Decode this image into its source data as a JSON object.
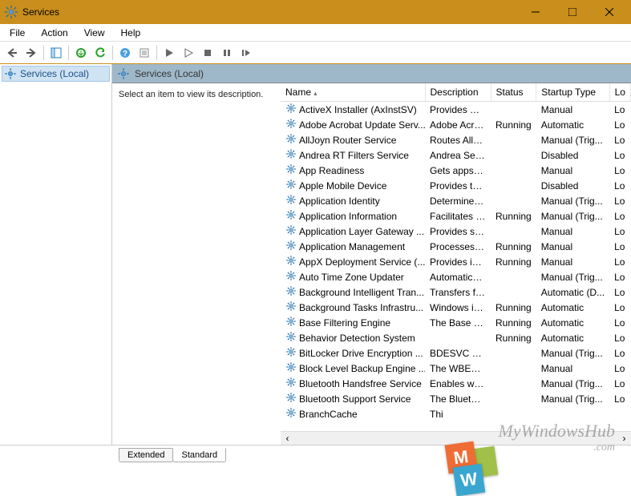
{
  "window": {
    "title": "Services"
  },
  "menu": {
    "file": "File",
    "action": "Action",
    "view": "View",
    "help": "Help"
  },
  "sidebar": {
    "label": "Services (Local)"
  },
  "content": {
    "header": "Services (Local)",
    "description_prompt": "Select an item to view its description."
  },
  "columns": {
    "name": "Name",
    "description": "Description",
    "status": "Status",
    "startup": "Startup Type",
    "logon": "Lo"
  },
  "tabs": {
    "extended": "Extended",
    "standard": "Standard"
  },
  "services": [
    {
      "name": "ActiveX Installer (AxInstSV)",
      "desc": "Provides Us...",
      "status": "",
      "startup": "Manual",
      "log": "Lo"
    },
    {
      "name": "Adobe Acrobat Update Serv...",
      "desc": "Adobe Acro...",
      "status": "Running",
      "startup": "Automatic",
      "log": "Lo"
    },
    {
      "name": "AllJoyn Router Service",
      "desc": "Routes AllJo...",
      "status": "",
      "startup": "Manual (Trig...",
      "log": "Lo"
    },
    {
      "name": "Andrea RT Filters Service",
      "desc": "Andrea Serv...",
      "status": "",
      "startup": "Disabled",
      "log": "Lo"
    },
    {
      "name": "App Readiness",
      "desc": "Gets apps re...",
      "status": "",
      "startup": "Manual",
      "log": "Lo"
    },
    {
      "name": "Apple Mobile Device",
      "desc": "Provides th...",
      "status": "",
      "startup": "Disabled",
      "log": "Lo"
    },
    {
      "name": "Application Identity",
      "desc": "Determines ...",
      "status": "",
      "startup": "Manual (Trig...",
      "log": "Lo"
    },
    {
      "name": "Application Information",
      "desc": "Facilitates t...",
      "status": "Running",
      "startup": "Manual (Trig...",
      "log": "Lo"
    },
    {
      "name": "Application Layer Gateway ...",
      "desc": "Provides su...",
      "status": "",
      "startup": "Manual",
      "log": "Lo"
    },
    {
      "name": "Application Management",
      "desc": "Processes in...",
      "status": "Running",
      "startup": "Manual",
      "log": "Lo"
    },
    {
      "name": "AppX Deployment Service (...",
      "desc": "Provides inf...",
      "status": "Running",
      "startup": "Manual",
      "log": "Lo"
    },
    {
      "name": "Auto Time Zone Updater",
      "desc": "Automatica...",
      "status": "",
      "startup": "Manual (Trig...",
      "log": "Lo"
    },
    {
      "name": "Background Intelligent Tran...",
      "desc": "Transfers fil...",
      "status": "",
      "startup": "Automatic (D...",
      "log": "Lo"
    },
    {
      "name": "Background Tasks Infrastru...",
      "desc": "Windows in...",
      "status": "Running",
      "startup": "Automatic",
      "log": "Lo"
    },
    {
      "name": "Base Filtering Engine",
      "desc": "The Base Fil...",
      "status": "Running",
      "startup": "Automatic",
      "log": "Lo"
    },
    {
      "name": "Behavior Detection System",
      "desc": "",
      "status": "Running",
      "startup": "Automatic",
      "log": "Lo"
    },
    {
      "name": "BitLocker Drive Encryption ...",
      "desc": "BDESVC hos...",
      "status": "",
      "startup": "Manual (Trig...",
      "log": "Lo"
    },
    {
      "name": "Block Level Backup Engine ...",
      "desc": "The WBENG...",
      "status": "",
      "startup": "Manual",
      "log": "Lo"
    },
    {
      "name": "Bluetooth Handsfree Service",
      "desc": "Enables wir...",
      "status": "",
      "startup": "Manual (Trig...",
      "log": "Lo"
    },
    {
      "name": "Bluetooth Support Service",
      "desc": "The Bluetoo...",
      "status": "",
      "startup": "Manual (Trig...",
      "log": "Lo"
    },
    {
      "name": "BranchCache",
      "desc": "Thi",
      "status": "",
      "startup": "",
      "log": ""
    }
  ],
  "watermark": {
    "text": "MyWindowsHub",
    "suffix": ".com"
  }
}
